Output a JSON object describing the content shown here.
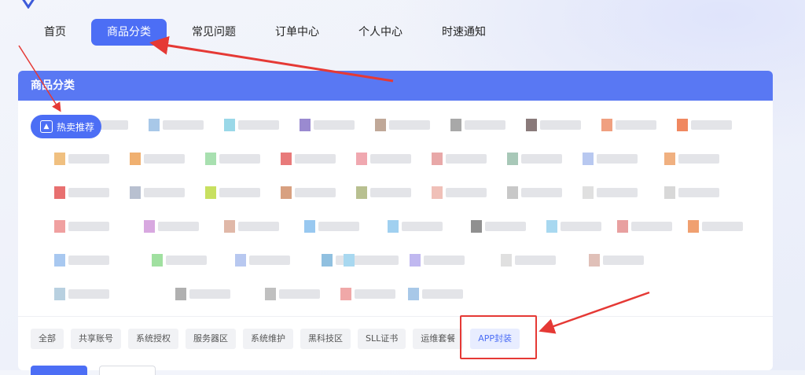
{
  "nav": {
    "items": [
      {
        "label": "首页"
      },
      {
        "label": "商品分类",
        "active": true
      },
      {
        "label": "常见问题"
      },
      {
        "label": "订单中心"
      },
      {
        "label": "个人中心"
      },
      {
        "label": "时速通知"
      }
    ]
  },
  "panel": {
    "title": "商品分类",
    "hot_label": "热卖推荐"
  },
  "tags": [
    {
      "label": "全部"
    },
    {
      "label": "共享账号"
    },
    {
      "label": "系统授权"
    },
    {
      "label": "服务器区"
    },
    {
      "label": "系统维护"
    },
    {
      "label": "黑科技区"
    },
    {
      "label": "SLL证书"
    },
    {
      "label": "运维套餐"
    },
    {
      "label": "APP封装",
      "active": true
    }
  ],
  "colors": {
    "accent": "#4c6ef5",
    "header": "#5978f3",
    "annotation": "#e53935"
  }
}
